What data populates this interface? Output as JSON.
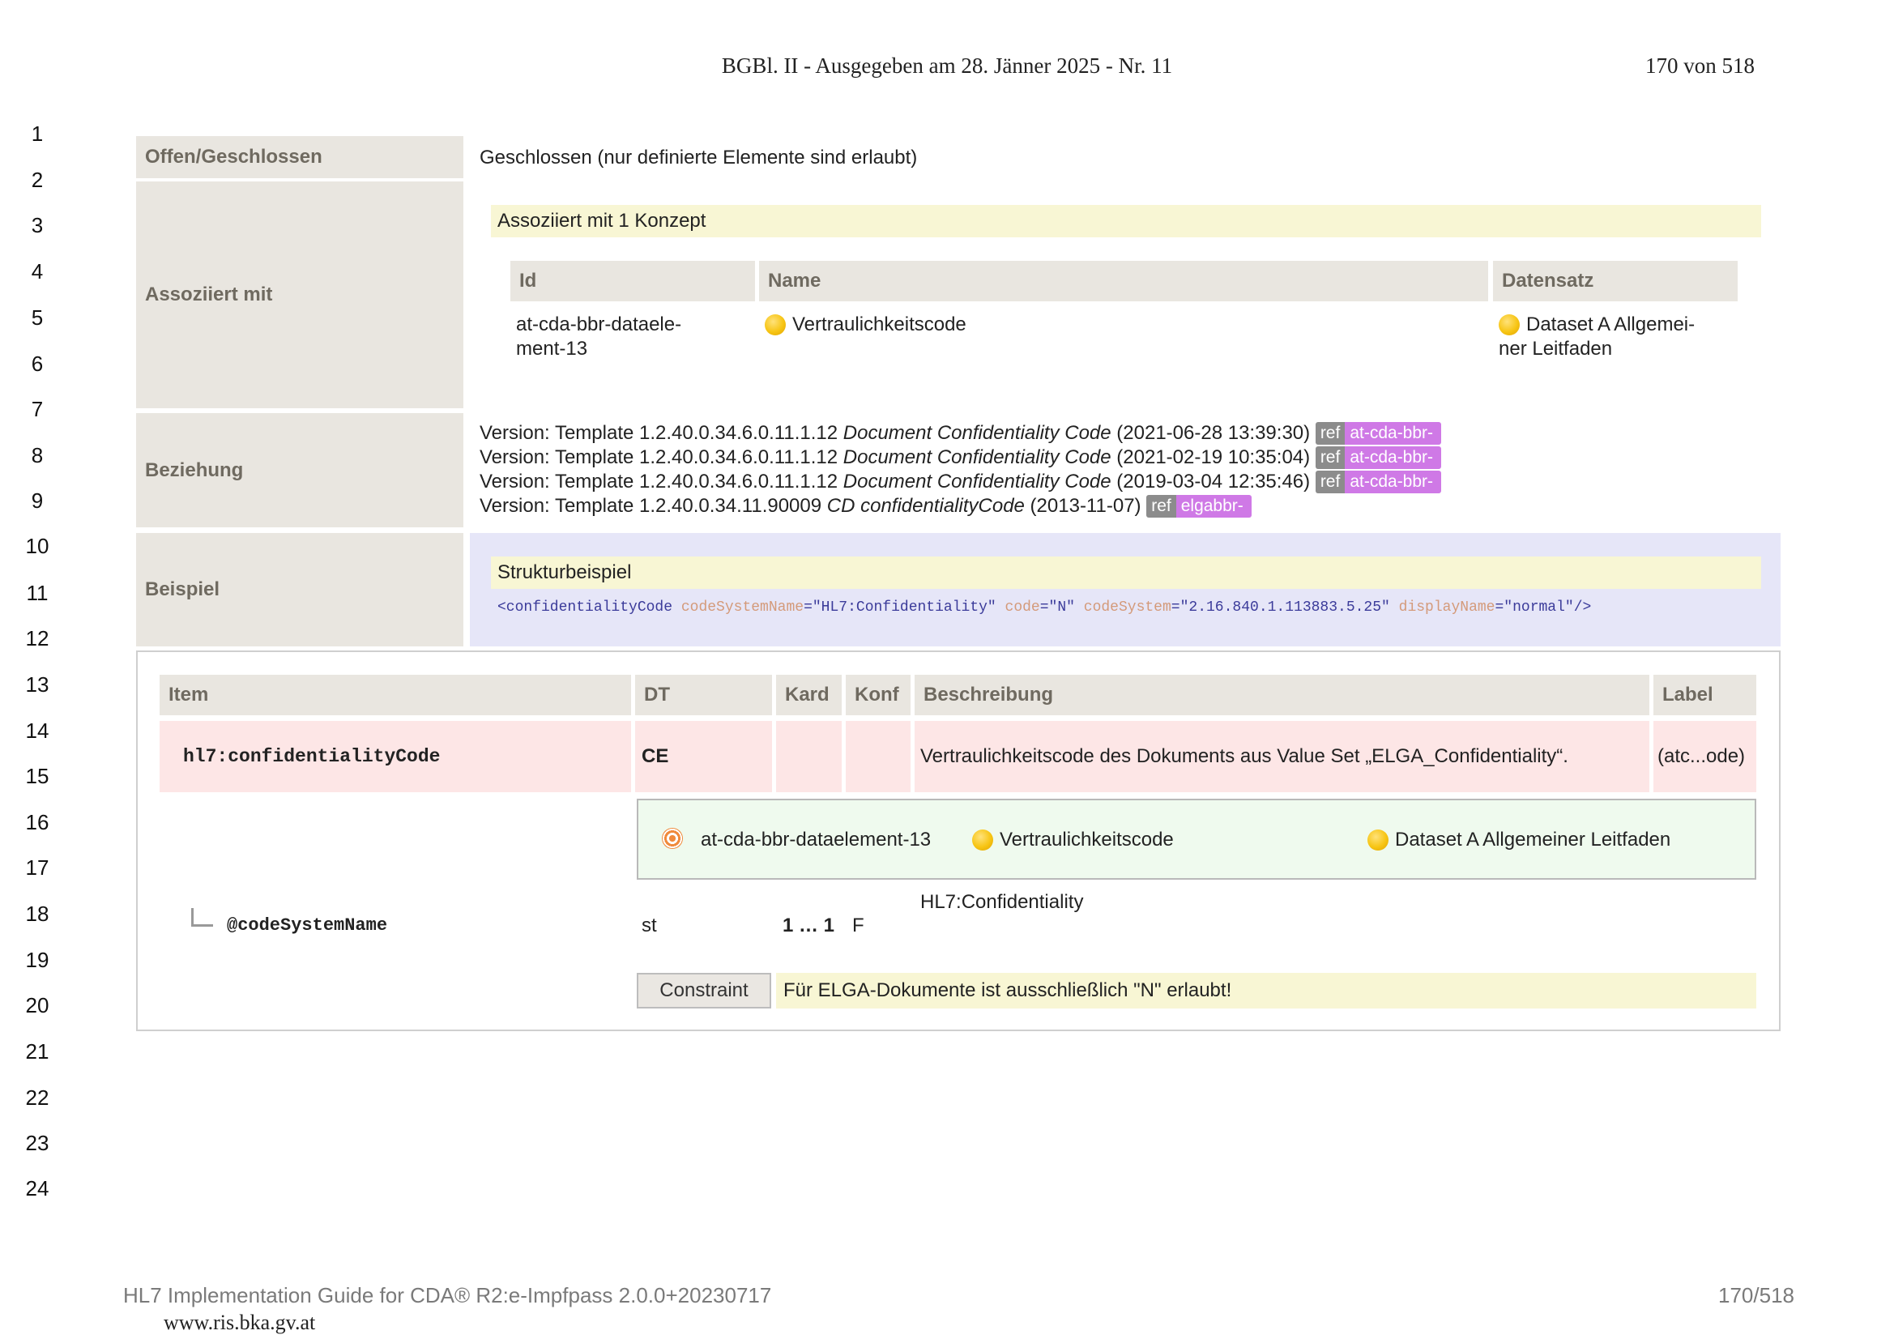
{
  "header": {
    "title": "BGBl. II - Ausgegeben am 28. Jänner 2025 - Nr. 11",
    "page": "170 von 518"
  },
  "line_numbers": [
    "1",
    "2",
    "3",
    "4",
    "5",
    "6",
    "7",
    "8",
    "9",
    "10",
    "11",
    "12",
    "13",
    "14",
    "15",
    "16",
    "17",
    "18",
    "19",
    "20",
    "21",
    "22",
    "23",
    "24"
  ],
  "rows": {
    "offen": {
      "label": "Offen/Geschlossen",
      "value": "Geschlossen (nur definierte Elemente sind erlaubt)"
    },
    "assoziiert": {
      "label": "Assoziiert mit",
      "banner": "Assoziiert mit 1 Konzept",
      "headers": {
        "id": "Id",
        "name": "Name",
        "datensatz": "Datensatz"
      },
      "row": {
        "id_line1": "at-cda-bbr-dataele-",
        "id_line2": "ment-13",
        "name": "Vertraulichkeitscode",
        "datensatz_line1": "Dataset A Allgemei-",
        "datensatz_line2": "ner Leitfaden"
      }
    },
    "beziehung": {
      "label": "Beziehung",
      "versions": [
        {
          "prefix": "Version: Template 1.2.40.0.34.6.0.11.1.12 ",
          "name": "Document Confidentiality Code",
          "date": " (2021-06-28 13:39:30)",
          "ref": "ref",
          "badge": "at-cda-bbr-"
        },
        {
          "prefix": "Version: Template 1.2.40.0.34.6.0.11.1.12 ",
          "name": "Document Confidentiality Code",
          "date": " (2021-02-19 10:35:04)",
          "ref": "ref",
          "badge": "at-cda-bbr-"
        },
        {
          "prefix": "Version: Template 1.2.40.0.34.6.0.11.1.12 ",
          "name": "Document Confidentiality Code",
          "date": " (2019-03-04 12:35:46)",
          "ref": "ref",
          "badge": "at-cda-bbr-"
        },
        {
          "prefix": "Version: Template 1.2.40.0.34.11.90009 ",
          "name": "CD confidentialityCode",
          "date": " (2013-11-07)",
          "ref": "ref",
          "badge": "elgabbr-"
        }
      ]
    },
    "beispiel": {
      "label": "Beispiel",
      "banner": "Strukturbeispiel",
      "code": {
        "tag_open": "<confidentialityCode ",
        "attr1": "codeSystemName",
        "val1": "=\"HL7:Confidentiality\" ",
        "attr2": "code",
        "val2": "=\"N\" ",
        "attr3": "codeSystem",
        "val3": "=\"2.16.840.1.113883.5.25\" ",
        "attr4": "displayName",
        "val4": "=\"normal\"",
        "tag_close": "/>"
      }
    }
  },
  "item_table": {
    "headers": {
      "item": "Item",
      "dt": "DT",
      "kard": "Kard",
      "konf": "Konf",
      "beschreibung": "Beschreibung",
      "label": "Label"
    },
    "main_row": {
      "item": "hl7:confidentialityCode",
      "dt": "CE",
      "kard": "",
      "konf": "",
      "beschreibung": "Vertraulichkeitscode des Dokuments aus Value Set „ELGA_Confidentiality“.",
      "label": "(atc...ode)"
    },
    "concept": {
      "id": "at-cda-bbr-dataelement-13",
      "name": "Vertraulichkeitscode",
      "dataset": "Dataset A Allgemeiner Leitfaden"
    },
    "sub_row": {
      "item": "@codeSystemName",
      "dt": "st",
      "kard": "1 … 1",
      "konf": "F",
      "beschreibung": "HL7:Confidentiality"
    },
    "constraint": {
      "button": "Constraint",
      "text": "Für ELGA-Dokumente ist ausschließlich \"N\" erlaubt!"
    }
  },
  "footer": {
    "guide": "HL7 Implementation Guide for CDA® R2:e-Impfpass 2.0.0+20230717",
    "page": "170/518",
    "url": "www.ris.bka.gv.at"
  }
}
